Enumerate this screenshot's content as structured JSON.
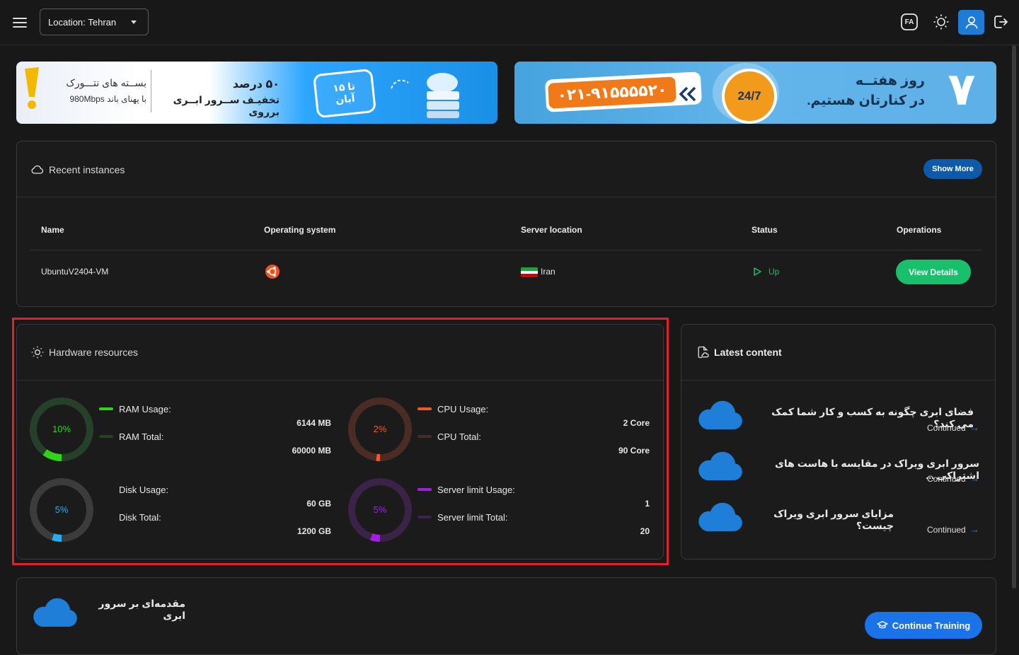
{
  "topbar": {
    "location_label": "Location:",
    "location_value": "Tehran",
    "lang_badge": "FA"
  },
  "banners": {
    "left": {
      "line1": "بســته های نتـــورک",
      "line2": "با پهنای باند 980Mbps",
      "promo1": "۵۰ درصد",
      "promo2": "تخفیـف ســرور ابــری برروی",
      "badge1": "تا ۱۵",
      "badge2": "آبان"
    },
    "right": {
      "phone": "۰۲۱-۹۱۵۵۵۵۲۰",
      "support": "24/7",
      "day_num": "۷",
      "line1": "روز هفتــه",
      "line2": "در کنارتان هستیم."
    }
  },
  "recent": {
    "title": "Recent instances",
    "show_more": "Show More",
    "headers": [
      "Name",
      "Operating system",
      "Server location",
      "Status",
      "Operations"
    ],
    "row": {
      "name": "UbuntuV2404-VM",
      "location": "Iran",
      "status": "Up",
      "action": "View Details"
    }
  },
  "hardware": {
    "title": "Hardware resources",
    "ram": {
      "pct_label": "10%",
      "pct": 0.1,
      "usage_label": "RAM Usage:",
      "total_label": "RAM Total:",
      "usage": "6144 MB",
      "total": "60000 MB",
      "color": "#2fd31a",
      "track": "#25412a"
    },
    "cpu": {
      "pct_label": "2%",
      "pct": 0.02,
      "usage_label": "CPU Usage:",
      "total_label": "CPU Total:",
      "usage": "2 Core",
      "total": "90 Core",
      "color": "#ef5a2a",
      "track": "#4a2c24"
    },
    "disk": {
      "pct_label": "5%",
      "pct": 0.05,
      "usage_label": "Disk Usage:",
      "total_label": "Disk Total:",
      "usage": "60 GB",
      "total": "1200 GB",
      "color": "#27aef0",
      "track": "#3c3c3c"
    },
    "server": {
      "pct_label": "5%",
      "pct": 0.05,
      "usage_label": "Server limit Usage:",
      "total_label": "Server limit Total:",
      "usage": "1",
      "total": "20",
      "color": "#a020e0",
      "track": "#3b2347"
    }
  },
  "latest": {
    "title": "Latest content",
    "items": [
      {
        "title": "فضای ابری چگونه به کسب و کار شما کمک می کند؟",
        "link": "Continued"
      },
      {
        "title": "سرور ابری ویراک در مقایسه با هاست های اشتراکی ...",
        "link": "Continued"
      },
      {
        "title": "مزایای سرور ابری ویراک چیست؟",
        "link": "Continued"
      }
    ]
  },
  "training": {
    "title": "مقدمه‌ای بر سرور ابری",
    "button": "Continue Training"
  }
}
